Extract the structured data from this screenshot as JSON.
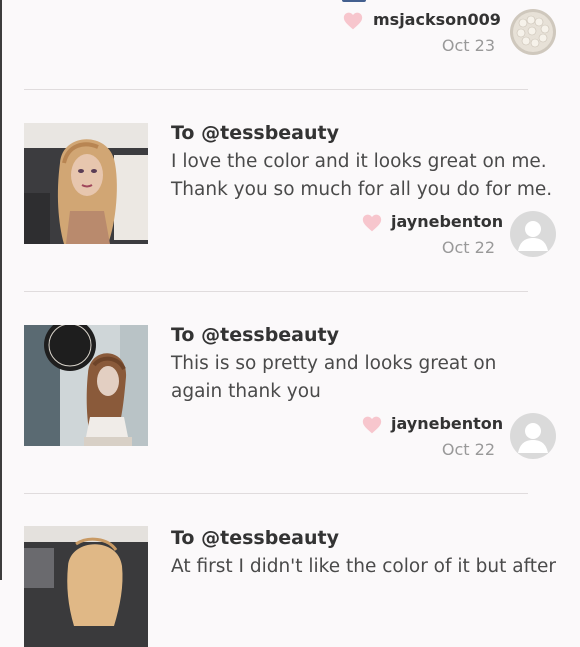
{
  "reviews": [
    {
      "username": "msjackson009",
      "date": "Oct 23"
    },
    {
      "title": "To @tessbeauty",
      "text": "I love the color and it looks great on me. Thank you so much for all you do for me.",
      "username": "jaynebenton",
      "date": "Oct 22"
    },
    {
      "title": "To @tessbeauty",
      "text": "This is so pretty and looks great on again thank you",
      "username": "jaynebenton",
      "date": "Oct 22"
    },
    {
      "title": "To @tessbeauty",
      "text": "At first I didn't like the color of it but after"
    }
  ],
  "colors": {
    "heart": "#f7c6cd",
    "divider": "#e0dcdd",
    "date": "#999999"
  },
  "icons": {
    "like": "heart-icon",
    "default_avatar": "person-icon"
  }
}
